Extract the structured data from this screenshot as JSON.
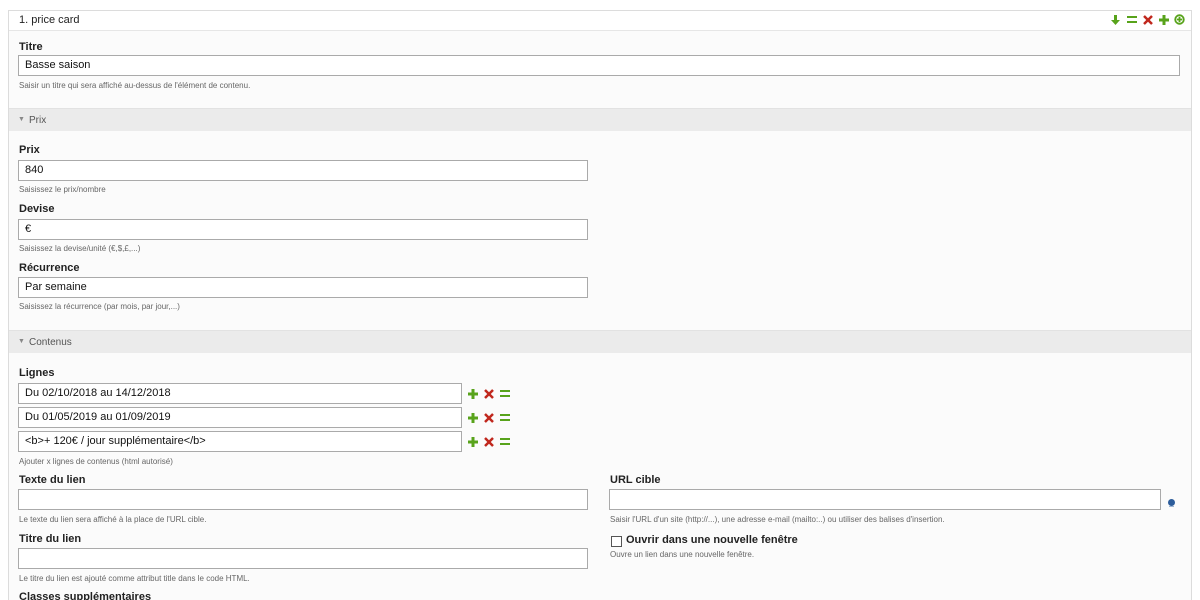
{
  "panel": {
    "title": "1. price card",
    "header_icons": [
      "arrow-down-icon",
      "drag-icon",
      "delete-icon",
      "add-icon",
      "add-circle-icon"
    ]
  },
  "titre": {
    "label": "Titre",
    "value": "Basse saison",
    "help": "Saisir un titre qui sera affiché au-dessus de l'élément de contenu."
  },
  "sections": {
    "prix": "Prix",
    "contenus": "Contenus"
  },
  "prix": {
    "label": "Prix",
    "value": "840",
    "help": "Saisissez le prix/nombre"
  },
  "devise": {
    "label": "Devise",
    "value": "€",
    "help": "Saisissez la devise/unité (€,$,£,...)"
  },
  "recurrence": {
    "label": "Récurrence",
    "value": "Par semaine",
    "help": "Saisissez la récurrence (par mois, par jour,...)"
  },
  "lignes": {
    "label": "Lignes",
    "rows": [
      "Du 02/10/2018 au 14/12/2018",
      "Du 01/05/2019 au 01/09/2019",
      "<b>+ 120€ / jour supplémentaire</b>"
    ],
    "help": "Ajouter x lignes de contenus (html autorisé)"
  },
  "texte_lien": {
    "label": "Texte du lien",
    "value": "",
    "help": "Le texte du lien sera affiché à la place de l'URL cible."
  },
  "url_cible": {
    "label": "URL cible",
    "value": "",
    "help": "Saisir l'URL d'un site (http://...), une adresse e-mail (mailto:..) ou utiliser des balises d'insertion."
  },
  "titre_lien": {
    "label": "Titre du lien",
    "value": "",
    "help": "Le titre du lien est ajouté comme attribut title dans le code HTML."
  },
  "nouvelle_fenetre": {
    "label": "Ouvrir dans une nouvelle fenêtre",
    "help": "Ouvre un lien dans une nouvelle fenêtre.",
    "checked": false
  },
  "classes": {
    "label": "Classes supplémentaires"
  },
  "colors": {
    "green": "#58a31b",
    "red": "#c0271d",
    "blue": "#2d5d9b"
  }
}
